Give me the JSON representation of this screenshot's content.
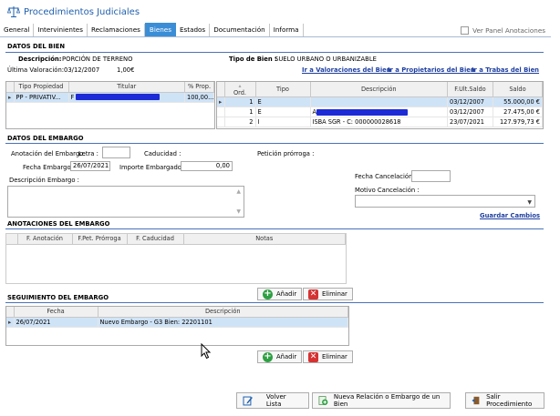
{
  "app": {
    "title": "Procedimientos Judiciales"
  },
  "tabs": [
    "General",
    "Intervinientes",
    "Reclamaciones",
    "Bienes",
    "Estados",
    "Documentación",
    "Informa"
  ],
  "active_tab": "Bienes",
  "panel_toggle": {
    "label": "Ver Panel Anotaciones",
    "checked": false
  },
  "datos_bien": {
    "section": "DATOS DEL BIEN",
    "desc_label": "Descripción:",
    "desc_value": "PORCIÓN DE TERRENO",
    "val_label": "Última Valoración:",
    "val_date": "03/12/2007",
    "val_amount": "1,00€",
    "tipo_label": "Tipo de Bien :",
    "tipo_value": "SUELO URBANO O URBANIZABLE",
    "links": [
      "Ir a Valoraciones del Bien",
      "Ir a Propietarios del Bien",
      "Ir a Trabas del Bien"
    ],
    "left_table": {
      "headers": [
        "Tipo Propiedad",
        "Titular",
        "% Prop."
      ],
      "rows": [
        [
          "PP - PRIVATIV...",
          "F",
          "100,00..."
        ]
      ]
    },
    "right_table": {
      "headers": [
        "Ord.",
        "Tipo",
        "Descripción",
        "F.Ult.Saldo",
        "Saldo"
      ],
      "rows": [
        [
          "1",
          "E",
          "",
          "03/12/2007",
          "55.000,00 €"
        ],
        [
          "1",
          "E",
          "A",
          "03/12/2007",
          "27.475,00 €"
        ],
        [
          "2",
          "I",
          "ISBA SGR - C: 000000028618",
          "23/07/2021",
          "127.979,73 €"
        ]
      ]
    }
  },
  "datos_embargo": {
    "section": "DATOS DEL EMBARGO",
    "anotacion_label": "Anotación del Embargo.",
    "letra_label": "Letra :",
    "caducidad_label": "Caducidad :",
    "peticion_label": "Petición prórroga :",
    "fecha_label": "Fecha Embargo :",
    "fecha_value": "26/07/2021",
    "importe_label": "Importe Embargado :",
    "importe_value": "0,00",
    "descripcion_label": "Descripción Embargo :",
    "fecha_cancel_label": "Fecha Cancelación :",
    "motivo_label": "Motivo Cancelación :",
    "guardar_label": "Guardar Cambios"
  },
  "anotaciones": {
    "section": "ANOTACIONES DEL EMBARGO",
    "headers": [
      "F. Anotación",
      "F.Pet. Prórroga",
      "F. Caducidad",
      "Notas"
    ]
  },
  "seguimiento": {
    "section": "SEGUIMIENTO DEL EMBARGO",
    "headers": [
      "Fecha",
      "Descripción"
    ],
    "rows": [
      [
        "26/07/2021",
        "Nuevo Embargo - G3 Bien: 22201101"
      ]
    ]
  },
  "buttons": {
    "add": "Añadir",
    "remove": "Eliminar",
    "volver": "Volver Lista",
    "nueva": "Nueva Relación o  Embargo de un Bien",
    "salir": "Salir Procedimiento"
  }
}
